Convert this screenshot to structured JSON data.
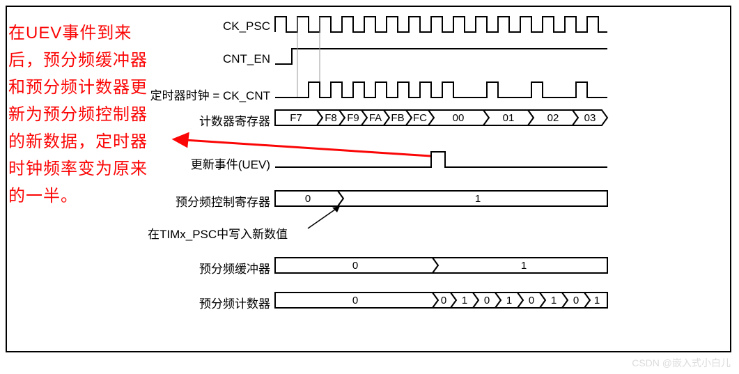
{
  "labels": {
    "ck_psc": "CK_PSC",
    "cnt_en": "CNT_EN",
    "timer_clock": "定时器时钟",
    "timer_clock_suffix": " = CK_CNT",
    "counter_reg": "计数器寄存器",
    "uev": "更新事件(UEV)",
    "psc_ctrl": "预分频控制寄存器",
    "psc_write_note": "在TIMx_PSC中写入新数值",
    "psc_buf": "预分频缓冲器",
    "psc_cnt": "预分频计数器"
  },
  "counter_values": [
    "F7",
    "F8",
    "F9",
    "FA",
    "FB",
    "FC",
    "00",
    "01",
    "02",
    "03"
  ],
  "psc_ctrl_values": {
    "before": "0",
    "after": "1"
  },
  "psc_buf_values": {
    "before": "0",
    "after": "1"
  },
  "psc_cnt_before": "0",
  "psc_cnt_after": [
    "0",
    "1",
    "0",
    "1",
    "0",
    "1",
    "0",
    "1"
  ],
  "red_note": "在UEV事件到来后，预分频缓冲器和预分频计数器更新为预分频控制器的新数据，定时器时钟频率变为原来的一半。",
  "watermark": "CSDN @嵌入式小白儿"
}
